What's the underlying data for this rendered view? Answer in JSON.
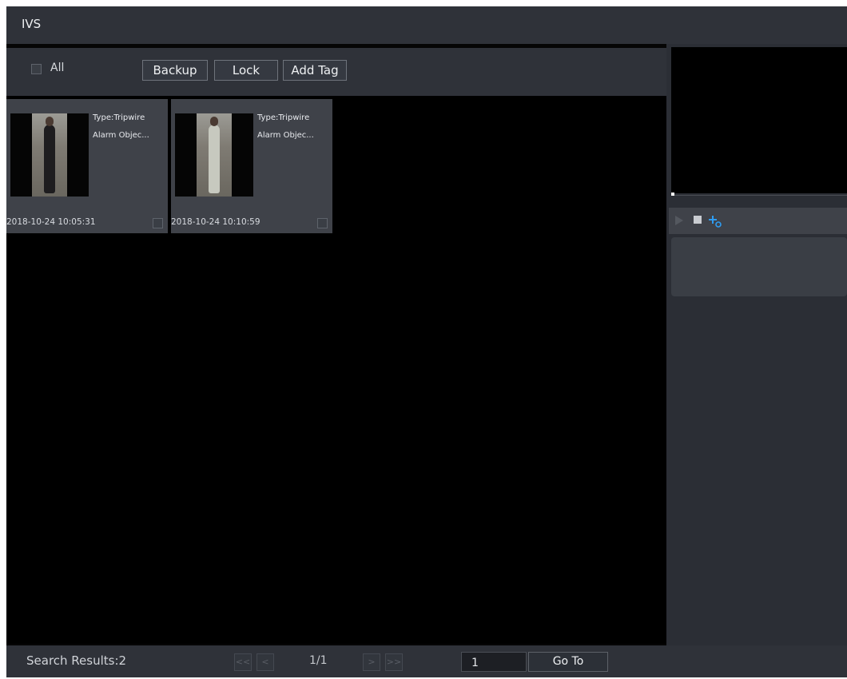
{
  "window": {
    "title": "IVS"
  },
  "toolbar": {
    "all_label": "All",
    "backup_label": "Backup",
    "lock_label": "Lock",
    "add_tag_label": "Add Tag"
  },
  "results": [
    {
      "type": "Type:Tripwire",
      "object": "Alarm Objec...",
      "time": "2018-10-24 10:05:31",
      "selected": false
    },
    {
      "type": "Type:Tripwire",
      "object": "Alarm Objec...",
      "time": "2018-10-24 10:10:59",
      "selected": false
    }
  ],
  "player": {
    "play_icon": "play-icon",
    "stop_icon": "stop-icon",
    "tag_icon": "add-tag-icon",
    "accent_color": "#2f9cf0"
  },
  "footer": {
    "search_results": "Search Results:2",
    "page_indicator": "1/1",
    "page_input_value": "1",
    "goto_label": "Go To",
    "first_label": "<<",
    "prev_label": "<",
    "next_label": ">",
    "last_label": ">>"
  }
}
